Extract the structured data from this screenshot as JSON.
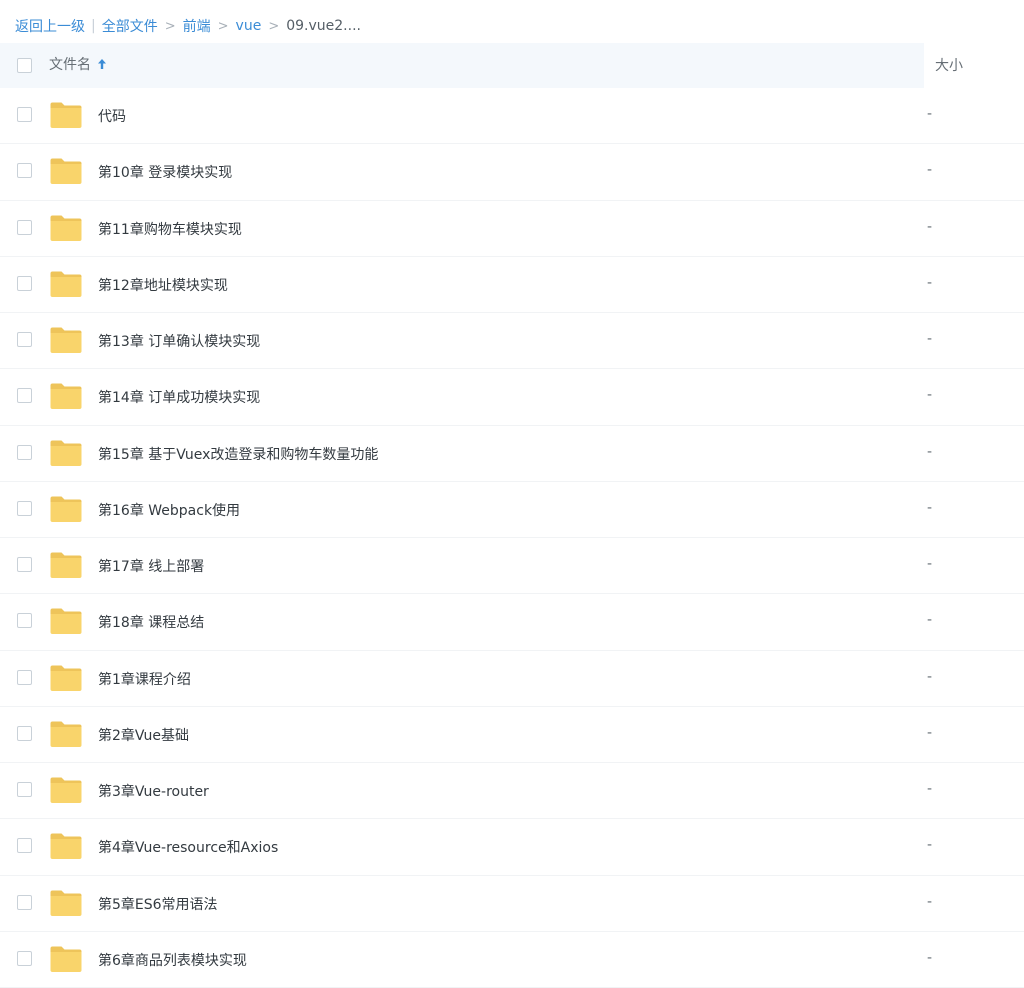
{
  "breadcrumb": {
    "back": "返回上一级",
    "all_files": "全部文件",
    "sep": ">",
    "path": [
      "前端",
      "vue"
    ],
    "current": "09.vue2...."
  },
  "header": {
    "name_label": "文件名",
    "size_label": "大小",
    "sort_icon": "arrow-up-icon"
  },
  "colors": {
    "link": "#3b8cd6",
    "folder": "#f9d46b",
    "header_bg": "#f4f8fc"
  },
  "files": [
    {
      "name": "代码",
      "size": "-",
      "icon": "folder-icon"
    },
    {
      "name": "第10章 登录模块实现",
      "size": "-",
      "icon": "folder-icon"
    },
    {
      "name": "第11章购物车模块实现",
      "size": "-",
      "icon": "folder-icon"
    },
    {
      "name": "第12章地址模块实现",
      "size": "-",
      "icon": "folder-icon"
    },
    {
      "name": "第13章 订单确认模块实现",
      "size": "-",
      "icon": "folder-icon"
    },
    {
      "name": "第14章 订单成功模块实现",
      "size": "-",
      "icon": "folder-icon"
    },
    {
      "name": "第15章 基于Vuex改造登录和购物车数量功能",
      "size": "-",
      "icon": "folder-icon"
    },
    {
      "name": "第16章 Webpack使用",
      "size": "-",
      "icon": "folder-icon"
    },
    {
      "name": "第17章 线上部署",
      "size": "-",
      "icon": "folder-icon"
    },
    {
      "name": "第18章 课程总结",
      "size": "-",
      "icon": "folder-icon"
    },
    {
      "name": "第1章课程介绍",
      "size": "-",
      "icon": "folder-icon"
    },
    {
      "name": "第2章Vue基础",
      "size": "-",
      "icon": "folder-icon"
    },
    {
      "name": "第3章Vue-router",
      "size": "-",
      "icon": "folder-icon"
    },
    {
      "name": "第4章Vue-resource和Axios",
      "size": "-",
      "icon": "folder-icon"
    },
    {
      "name": "第5章ES6常用语法",
      "size": "-",
      "icon": "folder-icon"
    },
    {
      "name": "第6章商品列表模块实现",
      "size": "-",
      "icon": "folder-icon"
    }
  ]
}
